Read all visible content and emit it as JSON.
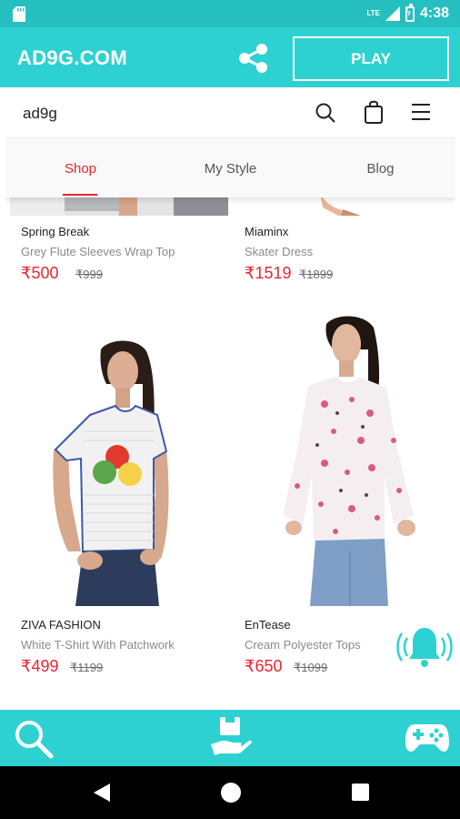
{
  "status_bar": {
    "network": "LTE",
    "time": "4:38"
  },
  "app_header": {
    "title": "AD9G.COM",
    "share_icon": "share-icon",
    "play_label": "PLAY"
  },
  "colors": {
    "teal_bar": "#2ed1d1",
    "status_teal": "#26bfbf",
    "price_red": "#e8262f"
  },
  "site": {
    "logo": "ad9g",
    "icons": [
      "search-icon",
      "bag-icon",
      "menu-icon"
    ],
    "tabs": [
      {
        "label": "Shop",
        "active": true
      },
      {
        "label": "My Style",
        "active": false
      },
      {
        "label": "Blog",
        "active": false
      }
    ]
  },
  "products": [
    {
      "brand": "Spring Break",
      "name": "Grey Flute Sleeves Wrap Top",
      "price": "₹500",
      "mrp": "₹999"
    },
    {
      "brand": "Miaminx",
      "name": "Skater Dress",
      "price": "₹1519",
      "mrp": "₹1899"
    },
    {
      "brand": "ZIVA FASHION",
      "name": "White T-Shirt With Patchwork",
      "price": "₹499",
      "mrp": "₹1199"
    },
    {
      "brand": "EnTease",
      "name": "Cream Polyester Tops",
      "price": "₹650",
      "mrp": "₹1099"
    }
  ],
  "floating": {
    "bell_icon": "bell-ring-icon"
  },
  "bottom_bar": {
    "icons": [
      "search-icon",
      "delivery-hand-icon",
      "gamepad-icon"
    ]
  },
  "nav_bar": {
    "icons": [
      "back-icon",
      "home-icon",
      "recents-icon"
    ]
  }
}
